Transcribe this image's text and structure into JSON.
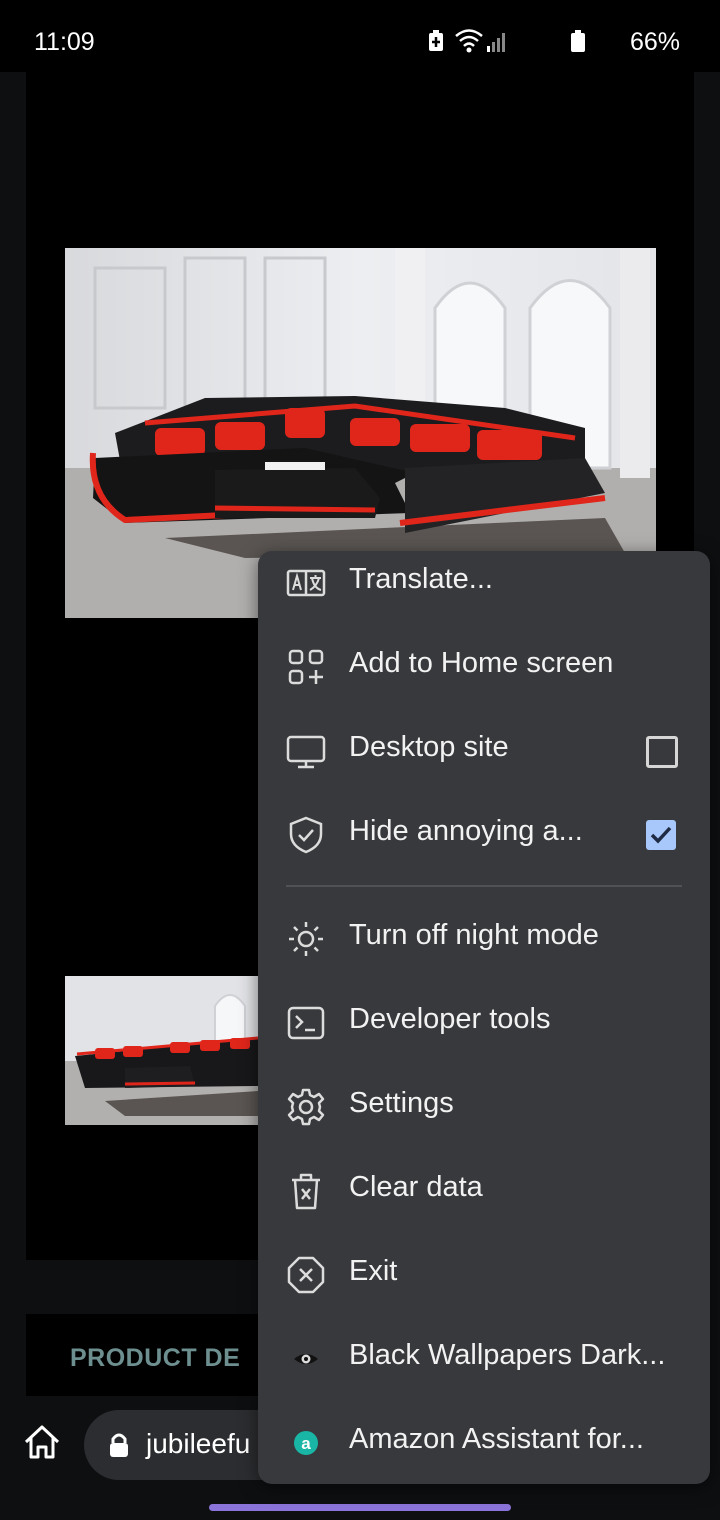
{
  "status_bar": {
    "time": "11:09",
    "battery": "66%"
  },
  "page": {
    "details_heading": "PRODUCT DE",
    "url": "jubileefu"
  },
  "menu": {
    "items": [
      {
        "label": "Translate...",
        "icon": "translate-icon"
      },
      {
        "label": "Add to Home screen",
        "icon": "add-to-home-icon"
      },
      {
        "label": "Desktop site",
        "icon": "monitor-icon",
        "checked": false
      },
      {
        "label": "Hide annoying a...",
        "icon": "shield-check-icon",
        "checked": true
      },
      {
        "label": "Turn off night mode",
        "icon": "sun-icon"
      },
      {
        "label": "Developer tools",
        "icon": "terminal-icon"
      },
      {
        "label": "Settings",
        "icon": "gear-icon"
      },
      {
        "label": "Clear data",
        "icon": "trash-icon"
      },
      {
        "label": "Exit",
        "icon": "close-circle-icon"
      },
      {
        "label": "Black Wallpapers Dark...",
        "icon": "eye-icon"
      },
      {
        "label": "Amazon Assistant for...",
        "icon": "amazon-a-icon"
      }
    ]
  },
  "colors": {
    "menu_bg": "#38393c",
    "checkbox_accent": "#a8c7fa",
    "heading_teal": "#6d8f8f",
    "gesture_bar": "#8b74d9",
    "sofa_red": "#e0261b"
  }
}
